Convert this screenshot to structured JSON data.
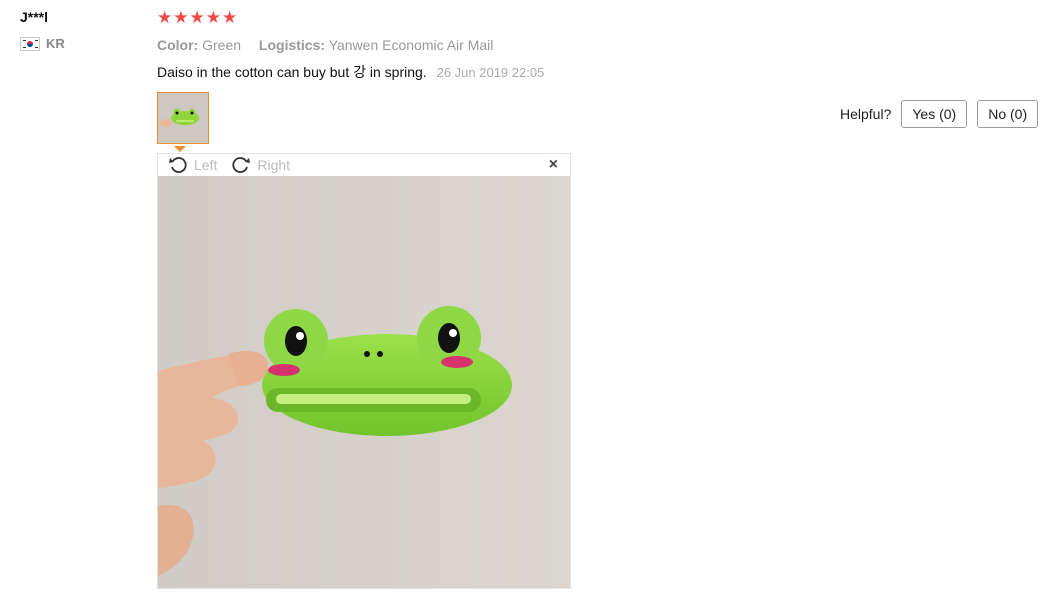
{
  "user": {
    "name": "J***l",
    "country": "KR"
  },
  "rating": {
    "stars": 5,
    "star_glyph": "★",
    "star_color": "#f04a49"
  },
  "meta": {
    "color_label": "Color:",
    "color_value": "Green",
    "logistics_label": "Logistics:",
    "logistics_value": "Yanwen Economic Air Mail"
  },
  "review": {
    "text": "Daiso in the cotton can buy but 강 in spring.",
    "date": "26 Jun 2019 22:05"
  },
  "viewer": {
    "rotate_left_label": "Left",
    "rotate_right_label": "Right",
    "close_glyph": "×",
    "icons": [
      "rotate-left-icon",
      "rotate-right-icon",
      "close-icon"
    ]
  },
  "helpful": {
    "label": "Helpful?",
    "yes_label": "Yes (0)",
    "no_label": "No (0)"
  },
  "colors": {
    "accent_orange": "#f08c2d",
    "star_red": "#f04a49"
  }
}
